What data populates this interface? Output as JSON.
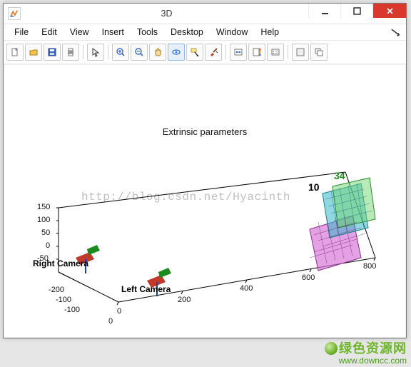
{
  "window": {
    "title": "3D"
  },
  "menus": [
    "File",
    "Edit",
    "View",
    "Insert",
    "Tools",
    "Desktop",
    "Window",
    "Help"
  ],
  "toolbar": {
    "groups": [
      [
        "new-file-icon",
        "open-folder-icon",
        "save-icon",
        "print-icon"
      ],
      [
        "pointer-icon"
      ],
      [
        "zoom-in-icon",
        "zoom-out-icon",
        "pan-icon",
        "rotate3d-icon",
        "datacursor-icon",
        "brush-icon"
      ],
      [
        "link-icon",
        "colorbar-icon",
        "legend-icon"
      ],
      [
        "tile-icon",
        "cascade-icon"
      ]
    ],
    "active": "rotate3d-icon"
  },
  "plot": {
    "title": "Extrinsic parameters",
    "watermark": "http://blog.csdn.net/Hyacinth",
    "xticks": [
      "0",
      "200",
      "400",
      "600",
      "800"
    ],
    "xticks2": [
      "-100",
      "0"
    ],
    "zticks": [
      "-50",
      "0",
      "50",
      "100",
      "150"
    ],
    "x2ticks": [
      "-200",
      "-100",
      "0"
    ],
    "labels": {
      "right_camera": "Right Camera",
      "left_camera": "Left Camera",
      "ten": "10",
      "thirtyfour": "34"
    }
  },
  "footer": {
    "brand_cn": "绿色资源网",
    "url": "www.downcc.com"
  }
}
